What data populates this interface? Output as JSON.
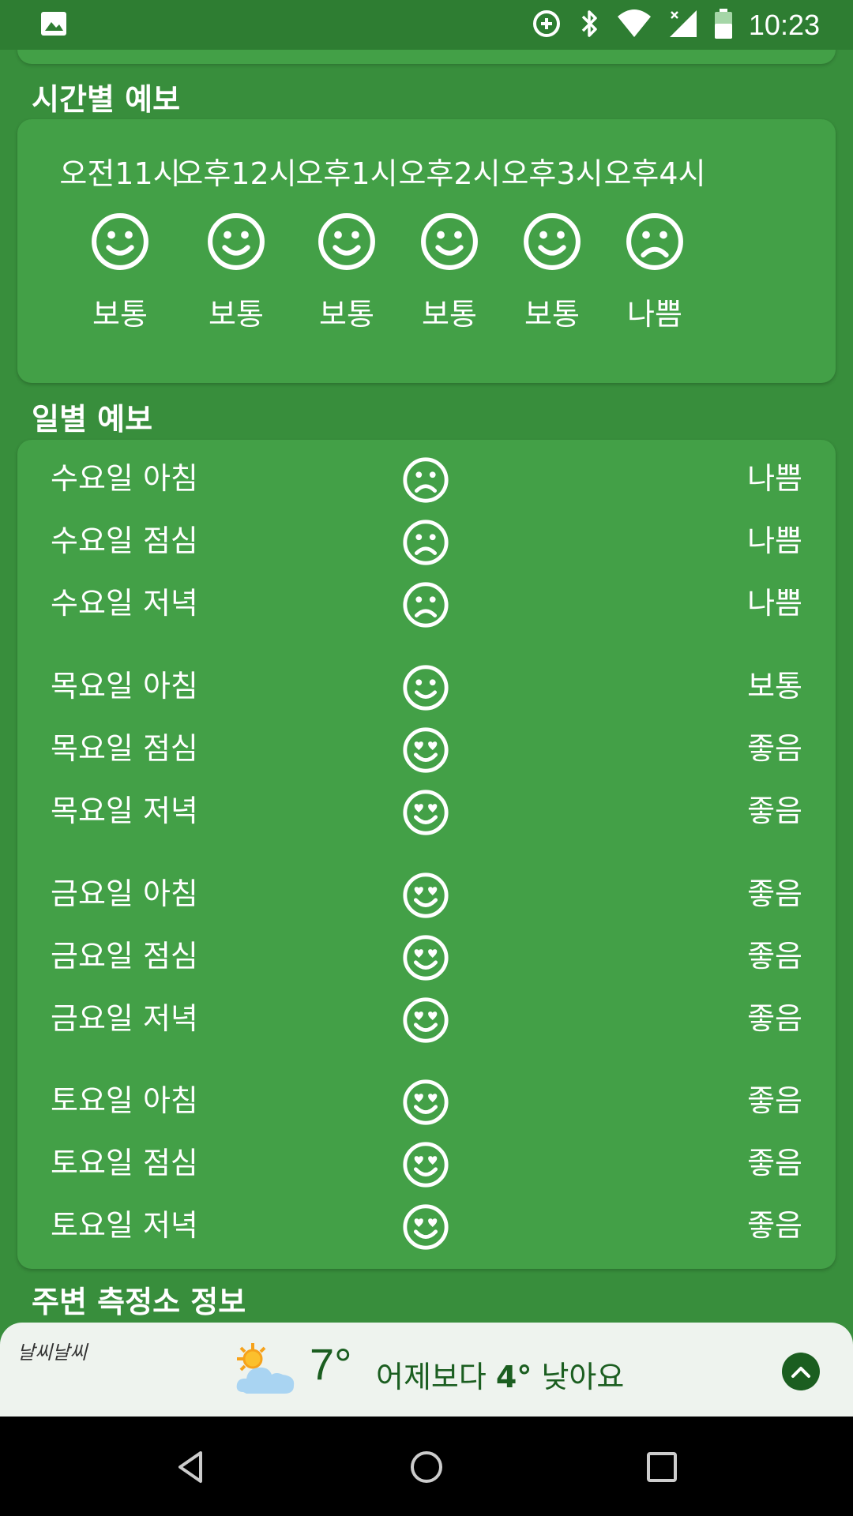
{
  "status_bar": {
    "time": "10:23",
    "icons": [
      "image-icon",
      "data-saver-icon",
      "bluetooth-icon",
      "wifi-icon",
      "signal-icon",
      "battery-icon"
    ]
  },
  "hourly": {
    "title": "시간별 예보",
    "items": [
      {
        "time": "오전11시",
        "status": "보통",
        "icon": "smile-face-icon"
      },
      {
        "time": "오후12시",
        "status": "보통",
        "icon": "smile-face-icon"
      },
      {
        "time": "오후1시",
        "status": "보통",
        "icon": "smile-face-icon"
      },
      {
        "time": "오후2시",
        "status": "보통",
        "icon": "smile-face-icon"
      },
      {
        "time": "오후3시",
        "status": "보통",
        "icon": "smile-face-icon"
      },
      {
        "time": "오후4시",
        "status": "나쁨",
        "icon": "frown-face-icon"
      }
    ]
  },
  "daily": {
    "title": "일별 예보",
    "groups": [
      [
        {
          "label": "수요일 아침",
          "status": "나쁨",
          "icon": "frown-face-icon"
        },
        {
          "label": "수요일 점심",
          "status": "나쁨",
          "icon": "frown-face-icon"
        },
        {
          "label": "수요일 저녁",
          "status": "나쁨",
          "icon": "frown-face-icon"
        }
      ],
      [
        {
          "label": "목요일 아침",
          "status": "보통",
          "icon": "smile-face-icon"
        },
        {
          "label": "목요일 점심",
          "status": "좋음",
          "icon": "heart-eyes-face-icon"
        },
        {
          "label": "목요일 저녁",
          "status": "좋음",
          "icon": "heart-eyes-face-icon"
        }
      ],
      [
        {
          "label": "금요일 아침",
          "status": "좋음",
          "icon": "heart-eyes-face-icon"
        },
        {
          "label": "금요일 점심",
          "status": "좋음",
          "icon": "heart-eyes-face-icon"
        },
        {
          "label": "금요일 저녁",
          "status": "좋음",
          "icon": "heart-eyes-face-icon"
        }
      ],
      [
        {
          "label": "토요일 아침",
          "status": "좋음",
          "icon": "heart-eyes-face-icon"
        },
        {
          "label": "토요일 점심",
          "status": "좋음",
          "icon": "heart-eyes-face-icon"
        },
        {
          "label": "토요일 저녁",
          "status": "좋음",
          "icon": "heart-eyes-face-icon"
        }
      ]
    ]
  },
  "nearby": {
    "title": "주변 측정소 정보"
  },
  "weather_widget": {
    "logo": "날씨날씨",
    "temperature": "7°",
    "message_prefix": "어제보다 ",
    "message_diff": "4°",
    "message_suffix": " 낮아요",
    "icon": "partly-cloudy-icon"
  },
  "nav_bar": {
    "icons": [
      "back-icon",
      "home-icon",
      "recents-icon"
    ]
  },
  "colors": {
    "background": "#388e3c",
    "card": "#43a047",
    "status_bar": "#2e7d32",
    "widget_bg": "#eef3ee",
    "widget_text": "#1b5e20"
  }
}
